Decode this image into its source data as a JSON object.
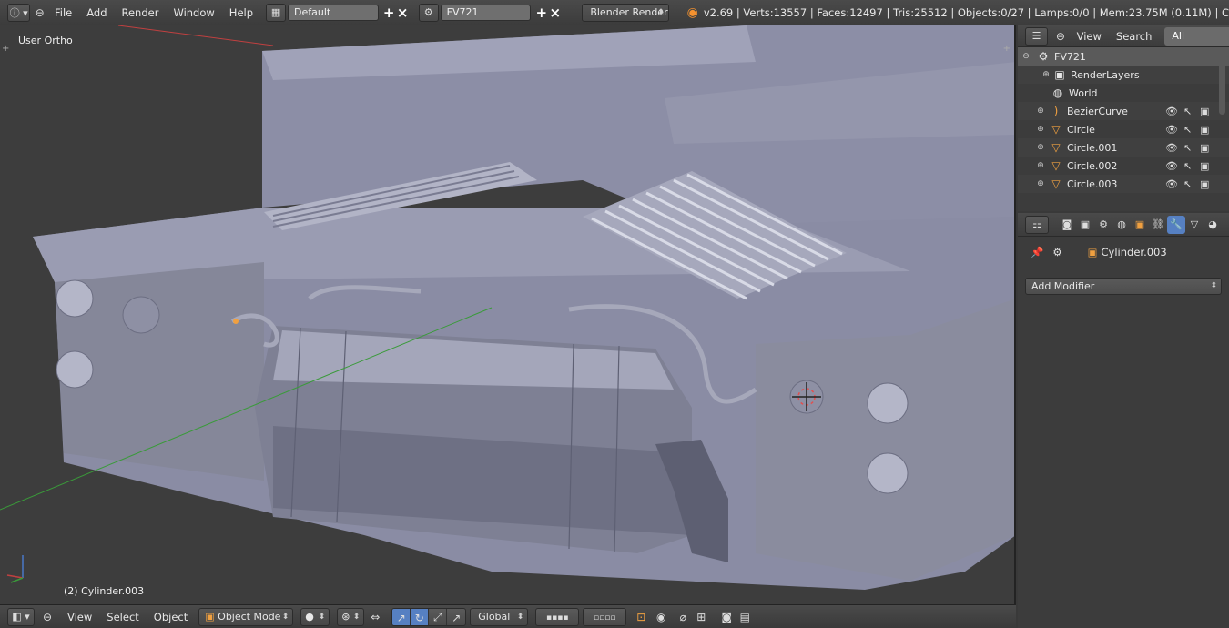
{
  "topbar": {
    "menus": [
      "File",
      "Add",
      "Render",
      "Window",
      "Help"
    ],
    "screen_layout": "Default",
    "scene": "FV721",
    "render_engine": "Blender Render",
    "stats": "v2.69 | Verts:13557 | Faces:12497 | Tris:25512 | Objects:0/27 | Lamps:0/0 | Mem:23.75M (0.11M) | C"
  },
  "viewport": {
    "view_label": "User Ortho",
    "object_label": "(2) Cylinder.003",
    "axis_x_color": "#c04040",
    "axis_y_color": "#3a9a3a",
    "axis_z_color": "#4a78c8"
  },
  "bottombar": {
    "menus": [
      "View",
      "Select",
      "Object"
    ],
    "mode": "Object Mode",
    "orientation": "Global"
  },
  "outliner": {
    "menus": [
      "View",
      "Search"
    ],
    "display": "All Scenes",
    "rows": [
      {
        "label": "FV721",
        "icon": "scene-icon"
      },
      {
        "label": "RenderLayers",
        "icon": "renderlayers-icon"
      },
      {
        "label": "World",
        "icon": "world-icon"
      },
      {
        "label": "BezierCurve",
        "icon": "curve-icon"
      },
      {
        "label": "Circle",
        "icon": "mesh-icon"
      },
      {
        "label": "Circle.001",
        "icon": "mesh-icon"
      },
      {
        "label": "Circle.002",
        "icon": "mesh-icon"
      },
      {
        "label": "Circle.003",
        "icon": "mesh-icon"
      }
    ]
  },
  "properties": {
    "object_name": "Cylinder.003",
    "add_modifier": "Add Modifier"
  }
}
